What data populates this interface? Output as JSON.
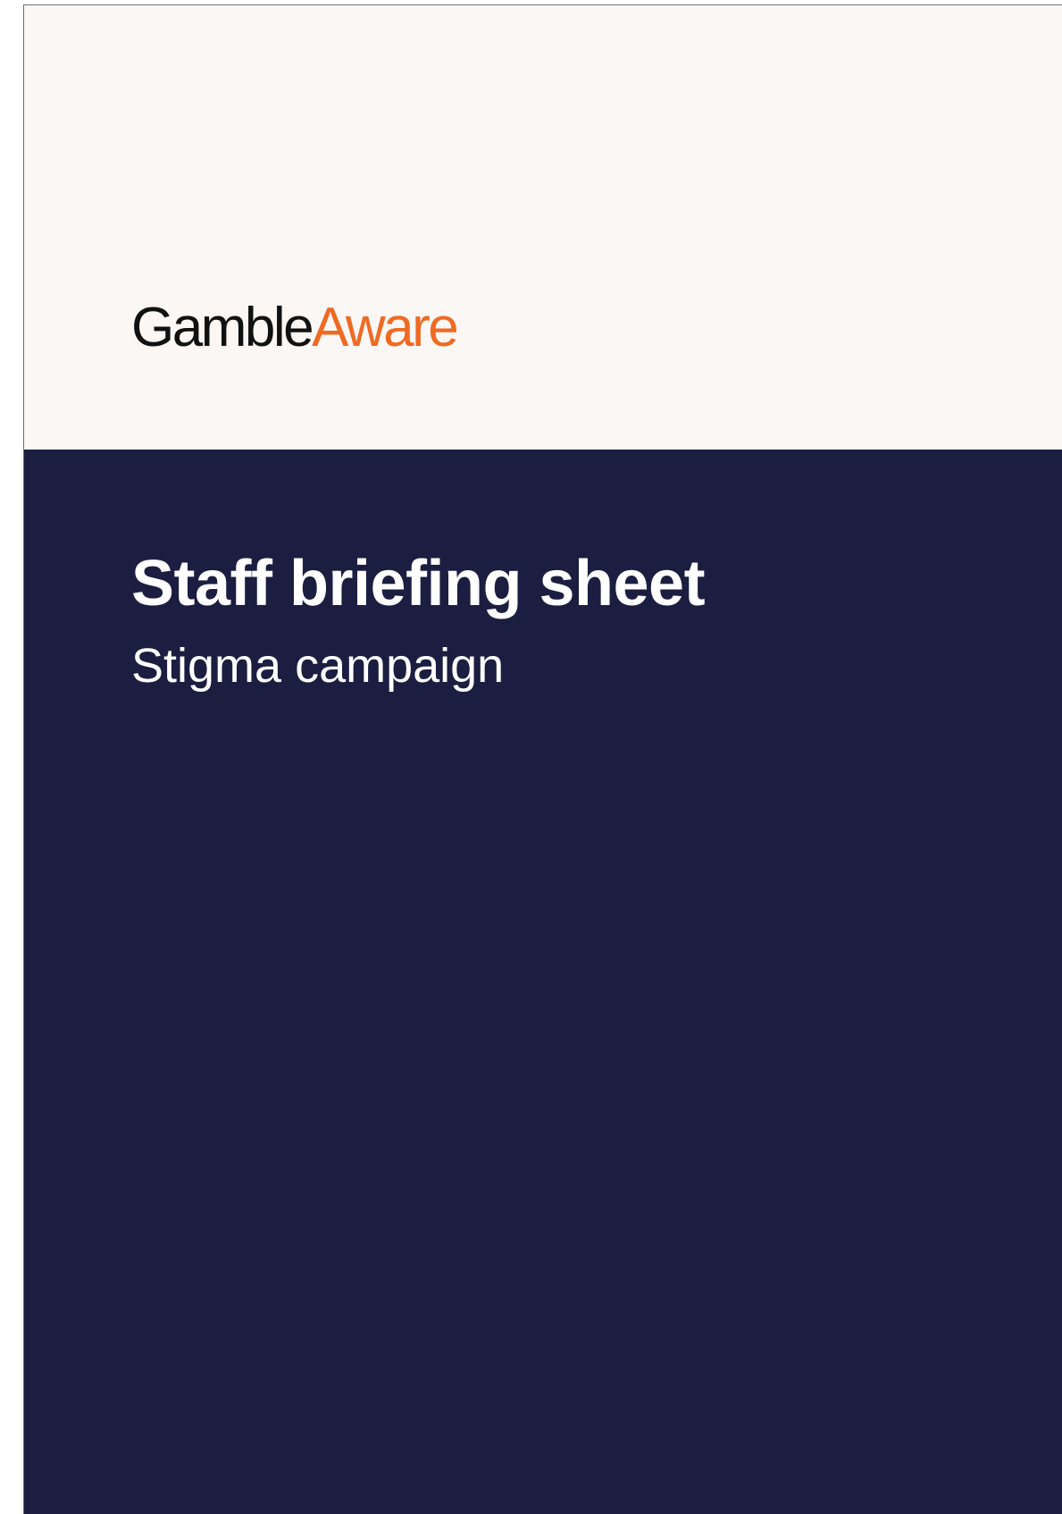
{
  "logo": {
    "part1": "Gamble",
    "part2": "Aware",
    "color_dark": "#111111",
    "color_accent": "#ef6a23"
  },
  "cover": {
    "title": "Staff briefing sheet",
    "subtitle": "Stigma campaign"
  },
  "colors": {
    "header_background": "#faf7f4",
    "body_background": "#1b1e40",
    "text_on_dark": "#ffffff"
  }
}
